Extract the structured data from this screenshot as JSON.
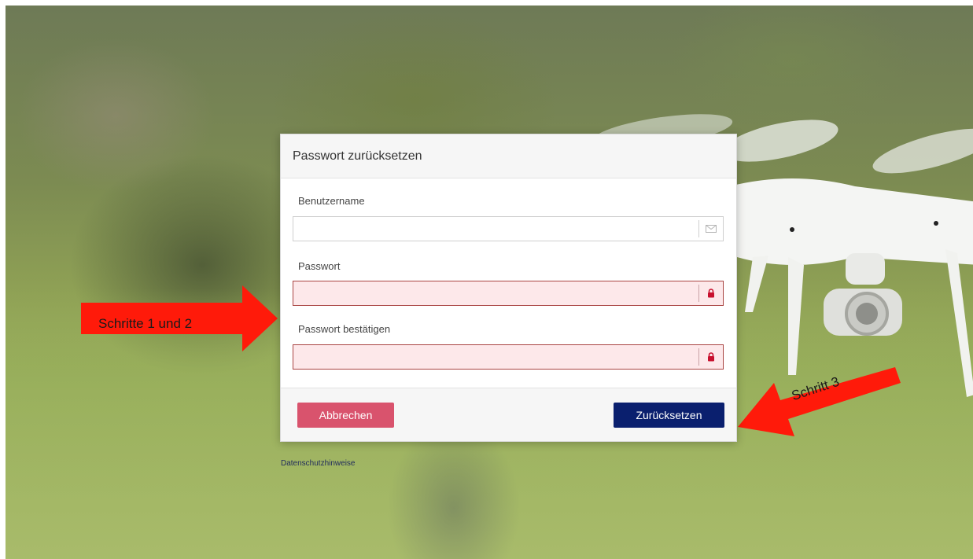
{
  "dialog": {
    "title": "Passwort zurücksetzen",
    "username_label": "Benutzername",
    "username_value": "",
    "password_label": "Passwort",
    "password_value": "",
    "confirm_label": "Passwort bestätigen",
    "confirm_value": "",
    "cancel_label": "Abbrechen",
    "reset_label": "Zurücksetzen"
  },
  "footer_link": "Datenschutzhinweise",
  "annotations": {
    "steps_1_2": "Schritte 1 und 2",
    "step_3": "Schritt 3"
  },
  "colors": {
    "cancel_button": "#d9536d",
    "reset_button": "#0a1f6e",
    "invalid_field_bg": "#fde8ea",
    "annotation_arrow": "#ff1a0a"
  },
  "icons": {
    "username_addon": "envelope-icon",
    "password_addon": "lock-icon",
    "confirm_addon": "lock-icon"
  }
}
